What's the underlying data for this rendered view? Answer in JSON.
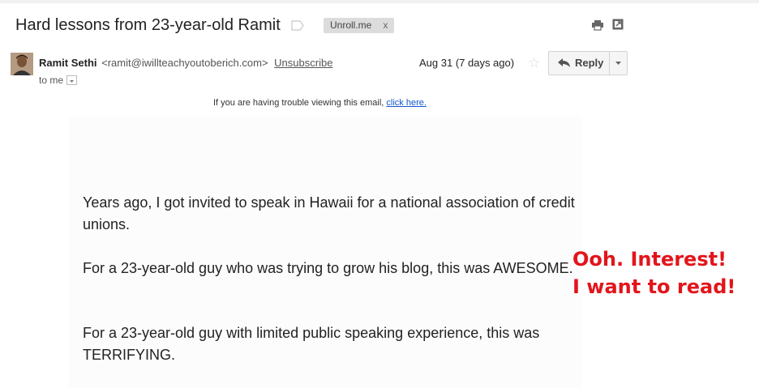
{
  "thread": {
    "subject": "Hard lessons from 23-year-old Ramit",
    "label_chip": "Unroll.me",
    "label_chip_close": "x"
  },
  "message": {
    "sender_name": "Ramit Sethi",
    "sender_email": "<ramit@iwillteachyoutoberich.com>",
    "unsubscribe": "Unsubscribe",
    "to": "to me",
    "date": "Aug 31 (7 days ago)",
    "reply_label": "Reply",
    "trouble_text": "If you are having trouble viewing this email, ",
    "trouble_link": "click here."
  },
  "body": {
    "para1": "Years ago, I got invited to speak in Hawaii for a national association of credit unions.",
    "para2": "For a 23-year-old guy who was trying to grow his blog, this was AWESOME.",
    "para3": "For a 23-year-old guy with limited public speaking experience, this was TERRIFYING."
  },
  "annotation": {
    "line1": "Ooh. Interest!",
    "line2": "I want to read!",
    "color": "#e2151b"
  }
}
